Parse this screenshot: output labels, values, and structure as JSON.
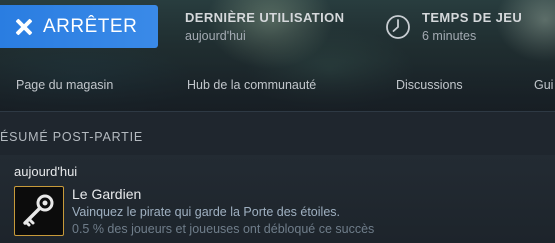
{
  "header": {
    "stop_button_label": "ARRÊTER",
    "last_played": {
      "title": "DERNIÈRE UTILISATION",
      "value": "aujourd'hui"
    },
    "play_time": {
      "title": "TEMPS DE JEU",
      "value": "6 minutes"
    }
  },
  "nav": {
    "items": [
      {
        "label": "Page du magasin"
      },
      {
        "label": "Hub de la communauté"
      },
      {
        "label": "Discussions"
      },
      {
        "label": "Gui"
      }
    ]
  },
  "post_game": {
    "section_title": "ÉSUMÉ POST-PARTIE",
    "date": "aujourd'hui",
    "achievement": {
      "icon": "key-icon",
      "name": "Le Gardien",
      "description": "Vainquez le pirate qui garde la Porte des étoiles.",
      "unlock_rate": "0.5 % des joueurs et joueuses ont débloqué ce succès"
    }
  },
  "colors": {
    "accent": "#2a7de1",
    "achievement_border": "#c79a3a"
  }
}
